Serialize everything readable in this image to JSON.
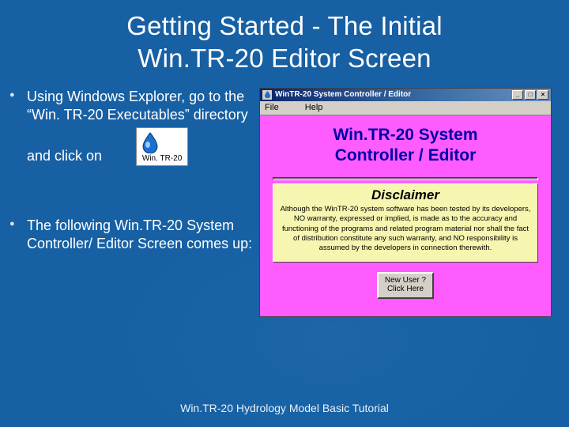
{
  "title_line1": "Getting Started - The Initial",
  "title_line2": "Win.TR-20 Editor Screen",
  "bullets": {
    "b1": "Using Windows Explorer, go to the “Win. TR-20 Executables” directory and click on",
    "b2": "The following Win.TR-20 System Controller/ Editor Screen comes up:"
  },
  "app_icon_caption": "Win. TR-20",
  "window": {
    "title": "WinTR-20 System Controller / Editor",
    "menu": {
      "file": "File",
      "help": "Help"
    },
    "heading_l1": "Win.TR-20 System",
    "heading_l2": "Controller / Editor",
    "disclaimer_heading": "Disclaimer",
    "disclaimer_text": "Although the WinTR-20 system software has been tested by its developers, NO warranty, expressed or implied, is made as to the accuracy and functioning of the programs and related program material nor shall the fact of distribution constitute any such warranty, and NO responsibility is assumed by the developers in connection therewith.",
    "newuser_l1": "New User ?",
    "newuser_l2": "Click Here",
    "buttons": {
      "min": "_",
      "max": "□",
      "close": "×"
    }
  },
  "footer": "Win.TR-20 Hydrology Model Basic Tutorial"
}
